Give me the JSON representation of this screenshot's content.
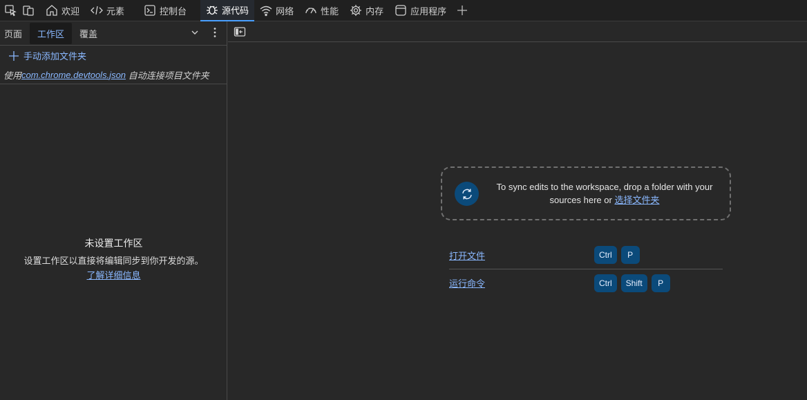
{
  "topbar": {
    "tabs": [
      {
        "label": "欢迎",
        "icon": "home-icon"
      },
      {
        "label": "元素",
        "icon": "code-icon"
      },
      {
        "label": "控制台",
        "icon": "console-icon"
      },
      {
        "label": "源代码",
        "icon": "bug-icon",
        "active": true
      },
      {
        "label": "网络",
        "icon": "wifi-icon"
      },
      {
        "label": "性能",
        "icon": "gauge-icon"
      },
      {
        "label": "内存",
        "icon": "chip-icon"
      },
      {
        "label": "应用程序",
        "icon": "app-window-icon"
      }
    ]
  },
  "left": {
    "tabs": [
      "页面",
      "工作区",
      "覆盖"
    ],
    "add_folder": "手动添加文件夹",
    "hint": {
      "prefix": "使用",
      "link": "com.chrome.devtools.json",
      "suffix": " 自动连接项目文件夹"
    },
    "empty": {
      "title": "未设置工作区",
      "desc": "设置工作区以直接将编辑同步到你开发的源。",
      "link": "了解详细信息"
    }
  },
  "right": {
    "drop": {
      "text": "To sync edits to the workspace, drop a folder with your sources here or ",
      "link": "选择文件夹"
    },
    "shortcuts": [
      {
        "label": "打开文件",
        "keys": [
          "Ctrl",
          "P"
        ]
      },
      {
        "label": "运行命令",
        "keys": [
          "Ctrl",
          "Shift",
          "P"
        ]
      }
    ]
  },
  "colors": {
    "accent": "#8ab8ff",
    "active_tab_underline": "#4aa0ff",
    "key_bg": "#0b4a7a",
    "background": "#282828"
  }
}
